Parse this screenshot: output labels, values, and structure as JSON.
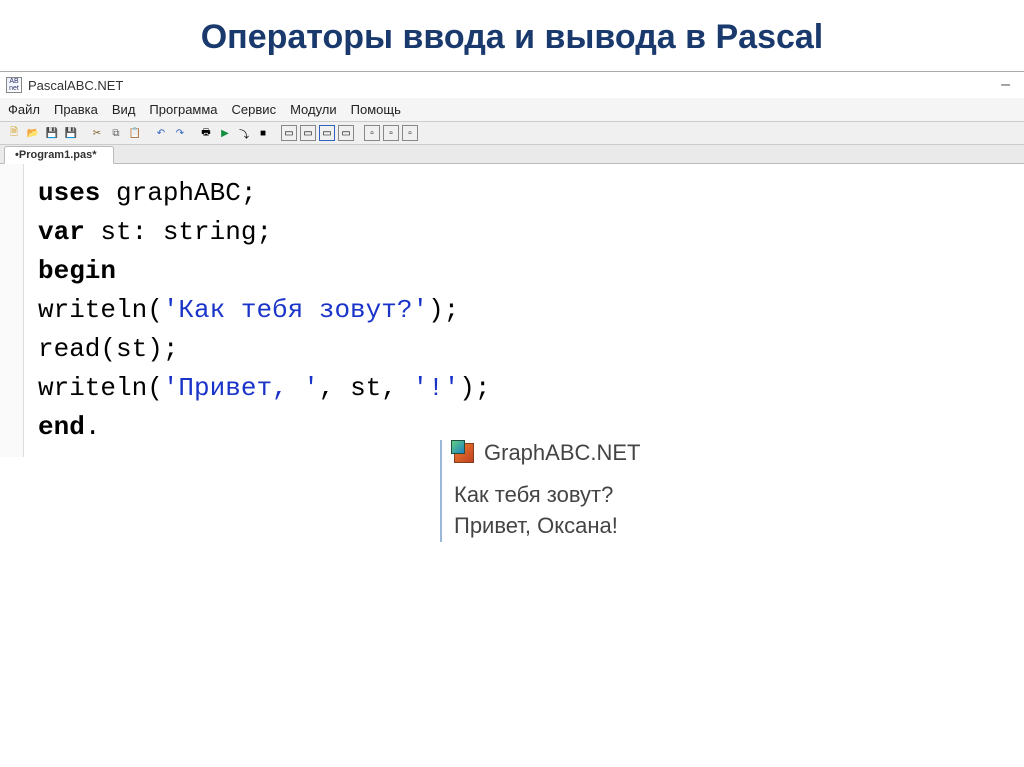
{
  "slide": {
    "title": "Операторы ввода и вывода в Pascal"
  },
  "ide": {
    "app_title": "PascalABC.NET",
    "menu": [
      "Файл",
      "Правка",
      "Вид",
      "Программа",
      "Сервис",
      "Модули",
      "Помощь"
    ],
    "tab": "•Program1.pas*",
    "code": {
      "l1_kw": "uses",
      "l1_rest": " graphABC;",
      "l2_kw": "var",
      "l2_rest": " st: ",
      "l2_type": "string",
      "l2_semi": ";",
      "l3_kw": "begin",
      "l4a": "writeln(",
      "l4_str": "'Как тебя зовут?'",
      "l4b": ");",
      "l5": "read(st);",
      "l6a": "writeln(",
      "l6_str1": "'Привет, '",
      "l6_mid": ", st, ",
      "l6_str2": "'!'",
      "l6b": ");",
      "l7_kw": "end",
      "l7_dot": "."
    },
    "toolbar_icons": [
      "new-file-icon",
      "open-file-icon",
      "save-icon",
      "save-all-icon",
      "sep",
      "cut-icon",
      "copy-icon",
      "paste-icon",
      "sep",
      "undo-icon",
      "redo-icon",
      "sep",
      "print-icon",
      "run-icon",
      "step-icon",
      "stop-icon",
      "sep",
      "pane1-icon",
      "pane2-icon",
      "pane3-icon",
      "pane4-icon",
      "sep",
      "out1-icon",
      "out2-icon",
      "out3-icon"
    ]
  },
  "output": {
    "title": "GraphABC.NET",
    "line1": "Как тебя зовут?",
    "line2": "Привет, Оксана!"
  }
}
